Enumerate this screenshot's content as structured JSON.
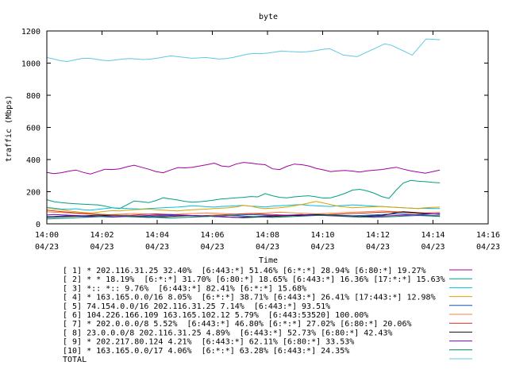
{
  "chart_data": {
    "type": "line",
    "title": "byte",
    "xlabel": "Time",
    "ylabel": "traffic (Mbps)",
    "ylim": [
      0,
      1200
    ],
    "yticks": [
      "0",
      "200",
      "400",
      "600",
      "800",
      "1000",
      "1200"
    ],
    "xticks": [
      {
        "time": "14:00",
        "date": "04/23"
      },
      {
        "time": "14:02",
        "date": "04/23"
      },
      {
        "time": "14:04",
        "date": "04/23"
      },
      {
        "time": "14:06",
        "date": "04/23"
      },
      {
        "time": "14:08",
        "date": "04/23"
      },
      {
        "time": "14:10",
        "date": "04/23"
      },
      {
        "time": "14:12",
        "date": "04/23"
      },
      {
        "time": "14:14",
        "date": "04/23"
      },
      {
        "time": "14:16",
        "date": "04/23"
      }
    ],
    "x_minutes": [
      0,
      0.33,
      0.67,
      1,
      1.33,
      1.67,
      2,
      2.33,
      2.67,
      3,
      3.33,
      3.67,
      4,
      4.33,
      4.67,
      5,
      5.33,
      5.67,
      6,
      6.33,
      6.67,
      7,
      7.33,
      7.67,
      8,
      8.33,
      8.67,
      9,
      9.33,
      9.67,
      10,
      10.33,
      10.67,
      11,
      11.33,
      11.67,
      12,
      12.33,
      12.67,
      13,
      13.33,
      13.67,
      14,
      14.33
    ],
    "series": [
      {
        "label": "[ 1] * 202.116.31.25 32.40%  [6:443:*] 51.46% [6:*:*] 28.94% [6:80:*] 19.27%",
        "color": "#a000a0",
        "values": [
          320,
          312,
          318,
          328,
          335,
          320,
          310,
          325,
          340,
          338,
          342,
          355,
          365,
          352,
          340,
          325,
          318,
          335,
          350,
          348,
          352,
          360,
          368,
          378,
          360,
          355,
          372,
          382,
          378,
          372,
          368,
          342,
          338,
          358,
          372,
          368,
          360,
          345,
          336,
          325,
          330,
          332,
          328,
          322,
          330,
          334,
          338,
          345,
          352,
          340,
          330,
          322,
          315,
          325,
          335
        ]
      },
      {
        "label": "[ 2] * * 18.19%  [6:*:*] 31.70% [6:80:*] 18.65% [6:443:*] 16.36% [17:*:*] 15.63%",
        "color": "#00a080",
        "values": [
          150,
          138,
          132,
          128,
          125,
          122,
          120,
          118,
          110,
          100,
          95,
          118,
          142,
          138,
          132,
          145,
          162,
          155,
          148,
          140,
          135,
          138,
          142,
          148,
          155,
          158,
          162,
          165,
          170,
          168,
          188,
          175,
          165,
          162,
          168,
          172,
          175,
          168,
          160,
          162,
          175,
          190,
          210,
          215,
          205,
          190,
          170,
          158,
          210,
          255,
          270,
          265,
          262,
          258,
          255
        ]
      },
      {
        "label": "[ 3] *:: *:: 9.76%  [6:443:*] 82.41% [6:*:*] 15.68%",
        "color": "#00c0e0",
        "values": [
          102,
          98,
          92,
          90,
          94,
          88,
          85,
          90,
          95,
          100,
          98,
          96,
          94,
          92,
          95,
          98,
          100,
          102,
          104,
          108,
          112,
          110,
          106,
          104,
          108,
          110,
          112,
          115,
          110,
          108,
          105,
          110,
          112,
          115,
          118,
          120,
          115,
          112,
          110,
          108,
          112,
          115,
          118,
          116,
          112,
          110,
          108,
          105,
          102,
          100,
          98,
          95,
          97,
          96,
          95
        ]
      },
      {
        "label": "[ 4] * 163.165.0.0/16 8.05%  [6:*:*] 38.71% [6:443:*] 26.41% [17:443:*] 12.98%",
        "color": "#e0a000",
        "values": [
          100,
          92,
          88,
          80,
          75,
          70,
          68,
          72,
          78,
          82,
          80,
          85,
          88,
          90,
          92,
          88,
          85,
          82,
          80,
          85,
          88,
          90,
          92,
          95,
          98,
          100,
          105,
          115,
          110,
          100,
          95,
          98,
          100,
          105,
          112,
          120,
          130,
          140,
          130,
          120,
          110,
          105,
          100,
          102,
          104,
          106,
          108,
          105,
          102,
          100,
          98,
          96,
          100,
          102,
          104
        ]
      },
      {
        "label": "[ 5] 74.154.0.0/16 202.116.31.25 7.14%  [6:443:*] 93.51%",
        "color": "#1050c0",
        "values": [
          45,
          46,
          48,
          50,
          48,
          46,
          44,
          46,
          48,
          50,
          52,
          54,
          50,
          48,
          46,
          48,
          50,
          52,
          54,
          52,
          50,
          48,
          46,
          48,
          50,
          52,
          54,
          56,
          58,
          56,
          54,
          52,
          50,
          52,
          54,
          56,
          58,
          60,
          58,
          56,
          54,
          52,
          50,
          52,
          54,
          56,
          58,
          60,
          62,
          60,
          58,
          56,
          54,
          52,
          50
        ]
      },
      {
        "label": "[ 6] 104.226.166.109 163.165.102.12 5.79%  [6:443:53520] 100.00%",
        "color": "#ff8040",
        "values": [
          75,
          72,
          70,
          68,
          65,
          62,
          60,
          58,
          56,
          58,
          60,
          62,
          64,
          62,
          60,
          58,
          56,
          58,
          60,
          62,
          64,
          66,
          68,
          66,
          64,
          62,
          60,
          62,
          64,
          66,
          68,
          70,
          72,
          70,
          68,
          66,
          64,
          62,
          64,
          66,
          68,
          70,
          72,
          74,
          76,
          78,
          80,
          78,
          76,
          74,
          72,
          70,
          68,
          70,
          72
        ]
      },
      {
        "label": "[ 7] * 202.0.0.0/8 5.52%  [6:443:*] 46.80% [6:*:*] 27.02% [6:80:*] 20.06%",
        "color": "#c03020",
        "values": [
          85,
          80,
          76,
          72,
          68,
          65,
          62,
          60,
          58,
          56,
          54,
          52,
          55,
          58,
          60,
          62,
          60,
          58,
          56,
          54,
          52,
          50,
          52,
          54,
          56,
          58,
          60,
          62,
          64,
          62,
          60,
          58,
          56,
          54,
          52,
          50,
          52,
          54,
          56,
          58,
          60,
          62,
          64,
          66,
          68,
          70,
          72,
          74,
          72,
          70,
          68,
          66,
          64,
          62,
          60
        ]
      },
      {
        "label": "[ 8] 23.0.0.0/8 202.116.31.25 4.89%  [6:443:*] 52.73% [6:80:*] 42.43%",
        "color": "#101010",
        "values": [
          40,
          42,
          44,
          46,
          48,
          50,
          52,
          54,
          52,
          50,
          48,
          46,
          44,
          42,
          40,
          42,
          44,
          46,
          48,
          50,
          52,
          50,
          48,
          46,
          44,
          42,
          40,
          38,
          40,
          42,
          44,
          46,
          48,
          50,
          52,
          54,
          56,
          58,
          56,
          54,
          52,
          50,
          48,
          46,
          48,
          50,
          52,
          60,
          70,
          75,
          72,
          68,
          65,
          62,
          60
        ]
      },
      {
        "label": "[ 9] * 202.217.80.124 4.21%  [6:443:*] 62.11% [6:80:*] 33.53%",
        "color": "#8000c0",
        "values": [
          55,
          58,
          56,
          54,
          52,
          50,
          48,
          46,
          44,
          42,
          44,
          46,
          48,
          50,
          52,
          54,
          56,
          58,
          56,
          54,
          52,
          50,
          48,
          46,
          44,
          42,
          40,
          42,
          44,
          46,
          48,
          50,
          52,
          54,
          56,
          58,
          56,
          54,
          52,
          50,
          48,
          46,
          44,
          42,
          44,
          46,
          48,
          50,
          52,
          54,
          56,
          58,
          60,
          62,
          64
        ]
      },
      {
        "label": "[10] * 163.165.0.0/17 4.06%  [6:*:*] 63.28% [6:443:*] 24.35%",
        "color": "#008060",
        "values": [
          30,
          32,
          34,
          36,
          38,
          40,
          42,
          44,
          46,
          48,
          50,
          48,
          46,
          44,
          42,
          40,
          38,
          36,
          38,
          40,
          42,
          44,
          46,
          48,
          50,
          52,
          50,
          48,
          46,
          44,
          42,
          40,
          42,
          44,
          46,
          48,
          50,
          52,
          54,
          52,
          50,
          48,
          46,
          44,
          42,
          40,
          42,
          44,
          46,
          48,
          50,
          52,
          50,
          48,
          46
        ]
      },
      {
        "label": "TOTAL",
        "color": "#60c8e0",
        "values": [
          1035,
          1025,
          1015,
          1010,
          1020,
          1028,
          1030,
          1025,
          1018,
          1015,
          1020,
          1025,
          1028,
          1025,
          1022,
          1025,
          1030,
          1038,
          1045,
          1040,
          1035,
          1030,
          1032,
          1035,
          1030,
          1025,
          1028,
          1035,
          1045,
          1055,
          1060,
          1058,
          1062,
          1068,
          1075,
          1072,
          1070,
          1068,
          1072,
          1078,
          1085,
          1090,
          1070,
          1050,
          1045,
          1040,
          1060,
          1080,
          1100,
          1120,
          1110,
          1090,
          1070,
          1050,
          1100,
          1150,
          1148,
          1145
        ]
      }
    ]
  }
}
